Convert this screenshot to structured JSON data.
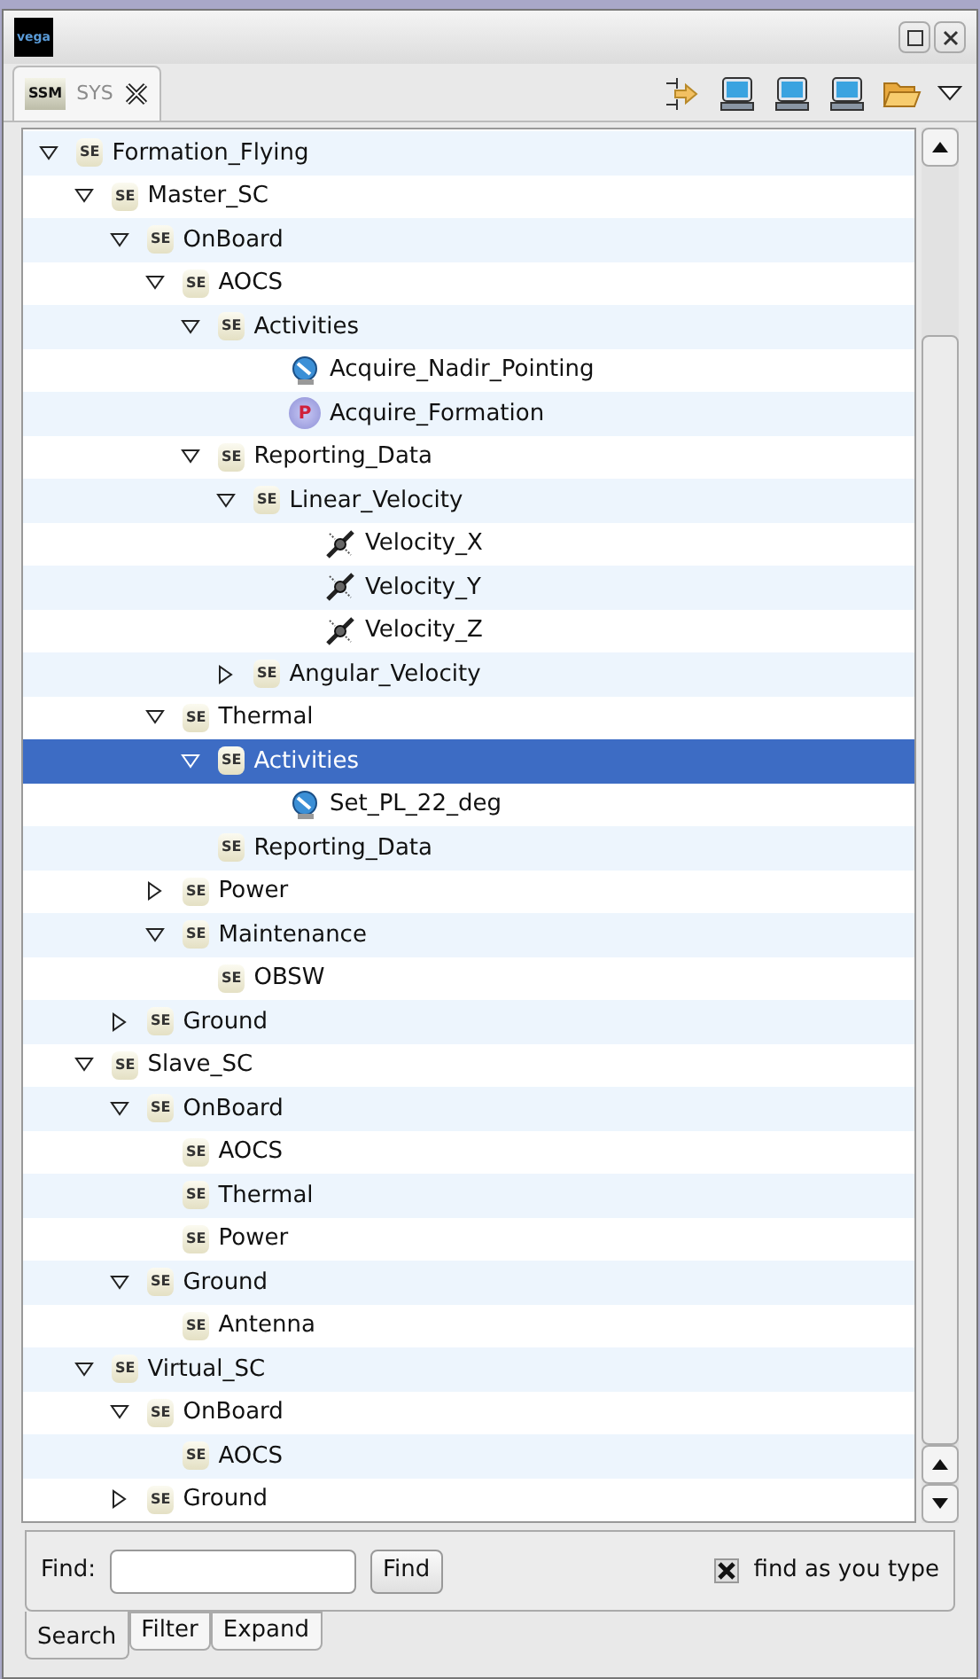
{
  "window": {
    "logo": "vega"
  },
  "view_tab": {
    "badge": "SSM",
    "label": "SYS",
    "selected": true
  },
  "tree": [
    {
      "label": "Formation_Flying",
      "badge": "SE",
      "expanded": true,
      "selected": false,
      "children": [
        {
          "label": "Master_SC",
          "badge": "SE",
          "expanded": true,
          "selected": false,
          "children": [
            {
              "label": "OnBoard",
              "badge": "SE",
              "expanded": true,
              "selected": false,
              "children": [
                {
                  "label": "AOCS",
                  "badge": "SE",
                  "expanded": true,
                  "selected": false,
                  "children": [
                    {
                      "label": "Activities",
                      "badge": "SE",
                      "expanded": true,
                      "selected": false,
                      "children": [
                        {
                          "label": "Acquire_Nadir_Pointing",
                          "kind": "activity",
                          "selected": false
                        },
                        {
                          "label": "Acquire_Formation",
                          "kind": "procedure",
                          "badge": "P",
                          "selected": false
                        }
                      ]
                    },
                    {
                      "label": "Reporting_Data",
                      "badge": "SE",
                      "expanded": true,
                      "selected": false,
                      "children": [
                        {
                          "label": "Linear_Velocity",
                          "badge": "SE",
                          "expanded": true,
                          "selected": false,
                          "children": [
                            {
                              "label": "Velocity_X",
                              "kind": "parameter",
                              "selected": false
                            },
                            {
                              "label": "Velocity_Y",
                              "kind": "parameter",
                              "selected": false
                            },
                            {
                              "label": "Velocity_Z",
                              "kind": "parameter",
                              "selected": false
                            }
                          ]
                        },
                        {
                          "label": "Angular_Velocity",
                          "badge": "SE",
                          "expanded": false,
                          "selected": false
                        }
                      ]
                    }
                  ]
                },
                {
                  "label": "Thermal",
                  "badge": "SE",
                  "expanded": true,
                  "selected": false,
                  "children": [
                    {
                      "label": "Activities",
                      "badge": "SE",
                      "expanded": true,
                      "selected": true,
                      "children": [
                        {
                          "label": "Set_PL_22_deg",
                          "kind": "activity",
                          "selected": false
                        }
                      ]
                    },
                    {
                      "label": "Reporting_Data",
                      "badge": "SE",
                      "selected": false
                    }
                  ]
                },
                {
                  "label": "Power",
                  "badge": "SE",
                  "expanded": false,
                  "selected": false
                },
                {
                  "label": "Maintenance",
                  "badge": "SE",
                  "expanded": true,
                  "selected": false,
                  "children": [
                    {
                      "label": "OBSW",
                      "badge": "SE",
                      "selected": false
                    }
                  ]
                }
              ]
            },
            {
              "label": "Ground",
              "badge": "SE",
              "expanded": false,
              "selected": false
            }
          ]
        },
        {
          "label": "Slave_SC",
          "badge": "SE",
          "expanded": true,
          "selected": false,
          "children": [
            {
              "label": "OnBoard",
              "badge": "SE",
              "expanded": true,
              "selected": false,
              "children": [
                {
                  "label": "AOCS",
                  "badge": "SE",
                  "selected": false
                },
                {
                  "label": "Thermal",
                  "badge": "SE",
                  "selected": false
                },
                {
                  "label": "Power",
                  "badge": "SE",
                  "selected": false
                }
              ]
            },
            {
              "label": "Ground",
              "badge": "SE",
              "expanded": true,
              "selected": false,
              "children": [
                {
                  "label": "Antenna",
                  "badge": "SE",
                  "selected": false
                }
              ]
            }
          ]
        },
        {
          "label": "Virtual_SC",
          "badge": "SE",
          "expanded": true,
          "selected": false,
          "children": [
            {
              "label": "OnBoard",
              "badge": "SE",
              "expanded": true,
              "selected": false,
              "children": [
                {
                  "label": "AOCS",
                  "badge": "SE",
                  "selected": false
                }
              ]
            },
            {
              "label": "Ground",
              "badge": "SE",
              "expanded": false,
              "selected": false
            }
          ]
        }
      ]
    }
  ],
  "find": {
    "label": "Find:",
    "button": "Find",
    "option": {
      "label": "find as you type",
      "checked": true
    }
  },
  "bottom_tabs": [
    {
      "label": "Search",
      "selected": true
    },
    {
      "label": "Filter",
      "selected": false
    },
    {
      "label": "Expand",
      "selected": false
    }
  ]
}
